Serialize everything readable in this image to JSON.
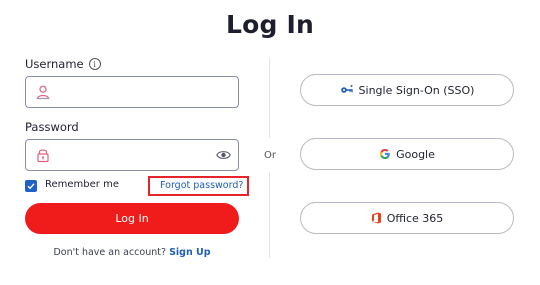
{
  "page": {
    "title": "Log In"
  },
  "form": {
    "username_label": "Username",
    "username_value": "",
    "password_label": "Password",
    "password_value": "",
    "remember_label": "Remember me",
    "remember_checked": true,
    "forgot_label": "Forgot password?",
    "login_label": "Log In",
    "no_account_text": "Don't have an account?",
    "signup_label": "Sign Up"
  },
  "divider": {
    "or_label": "Or"
  },
  "providers": [
    {
      "label": "Single Sign-On (SSO)",
      "icon": "key-icon"
    },
    {
      "label": "Google",
      "icon": "google-icon"
    },
    {
      "label": "Office 365",
      "icon": "office-icon"
    }
  ],
  "colors": {
    "primary_red": "#f01c1c",
    "link_blue": "#1f5fb4",
    "checkbox_blue": "#2160c7",
    "highlight_red": "#e5252a"
  }
}
